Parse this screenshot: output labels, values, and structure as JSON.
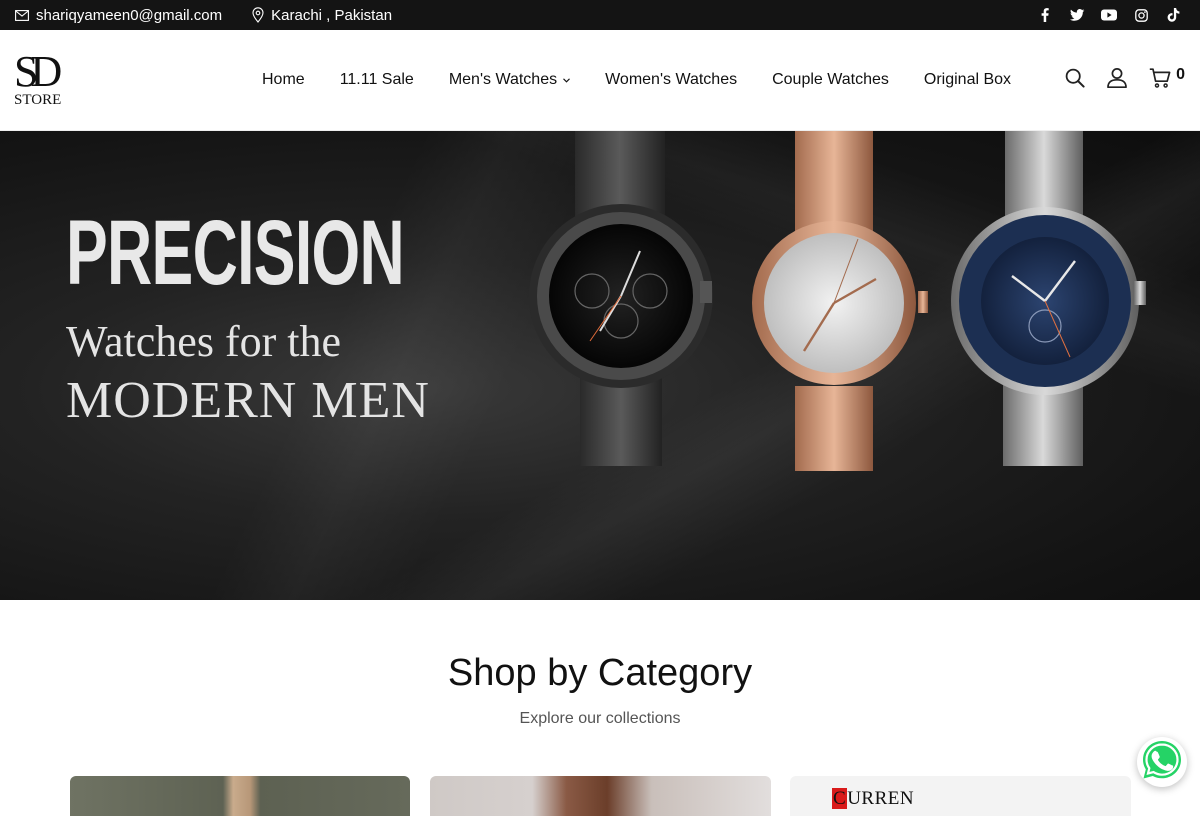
{
  "topbar": {
    "email": "shariqyameen0@gmail.com",
    "location": "Karachi , Pakistan",
    "email_icon": "mail-icon",
    "location_icon": "map-pin-icon",
    "social": [
      "facebook-icon",
      "twitter-icon",
      "youtube-icon",
      "instagram-icon",
      "tiktok-icon"
    ]
  },
  "header": {
    "logo_mark": "SD",
    "logo_text": "STORE",
    "nav": [
      {
        "label": "Home"
      },
      {
        "label": "11.11 Sale"
      },
      {
        "label": "Men's Watches",
        "has_dropdown": true
      },
      {
        "label": "Women's Watches"
      },
      {
        "label": "Couple Watches"
      },
      {
        "label": "Original Box"
      }
    ],
    "cart_count": "0",
    "icons": [
      "search-icon",
      "user-icon",
      "cart-icon"
    ]
  },
  "hero": {
    "title": "PRECISION",
    "subtitle_line1": "Watches for the",
    "subtitle_line2": "MODERN MEN"
  },
  "category_section": {
    "title": "Shop by Category",
    "subtitle": "Explore our collections",
    "card3_brand": "CURREN"
  },
  "colors": {
    "topbar_bg": "#141414",
    "whatsapp": "#25D366",
    "accent_rose": "#c98f6a",
    "accent_navy": "#1c2f52"
  }
}
